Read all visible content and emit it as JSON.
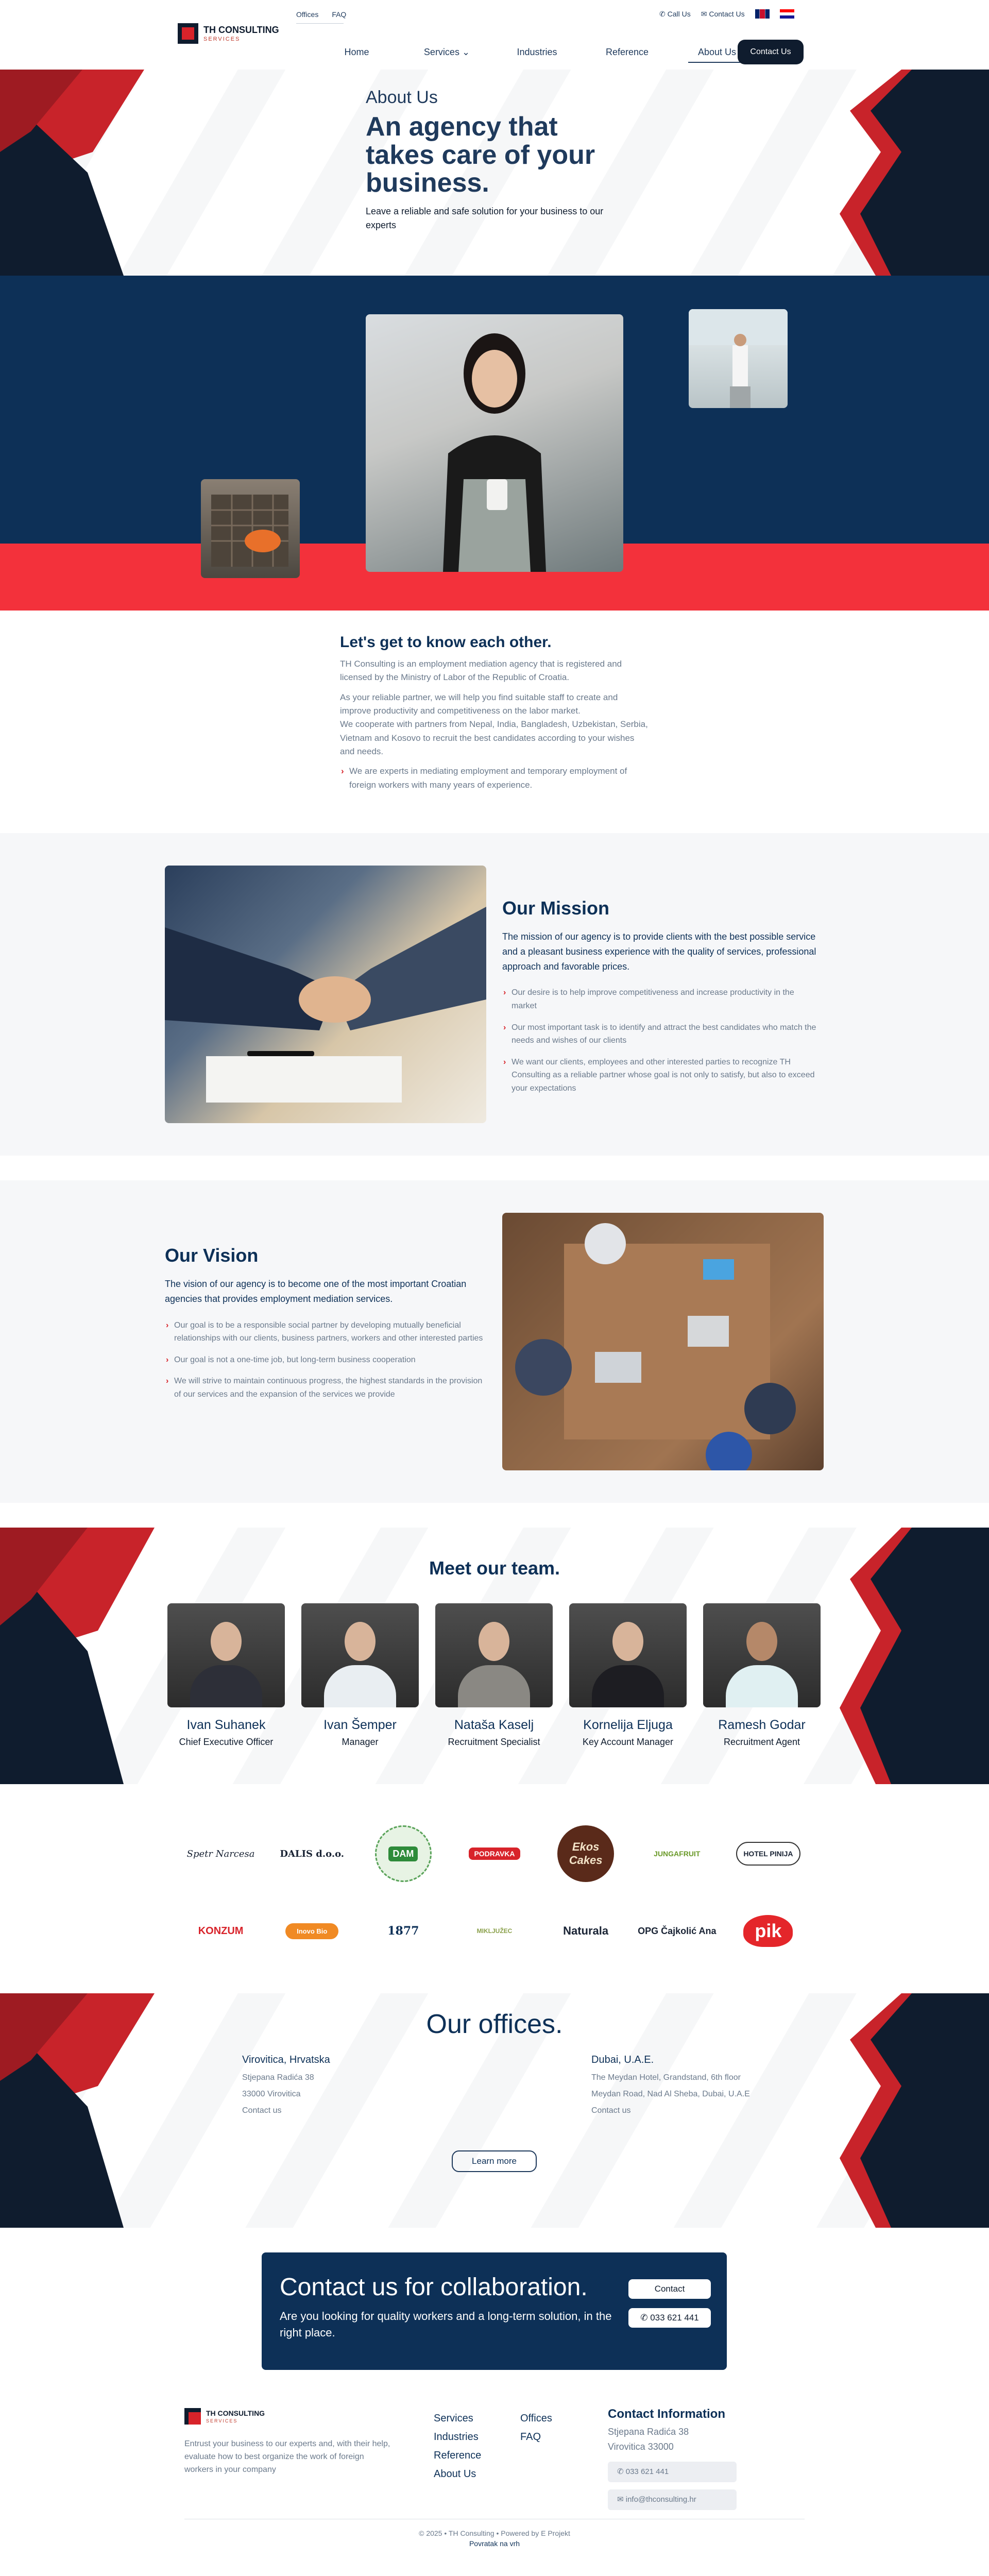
{
  "header": {
    "logo_name": "TH CONSULTING",
    "logo_sub": "SERVICES",
    "top_links": [
      "Offices",
      "FAQ"
    ],
    "call_us": "Call Us",
    "contact_us": "Contact Us",
    "nav": [
      "Home",
      "Services",
      "Industries",
      "Reference",
      "About Us"
    ],
    "contact_button": "Contact Us"
  },
  "hero": {
    "small_title": "About Us",
    "title": "An agency that takes care of your business.",
    "lead": "Leave a reliable and safe solution for your business to our experts"
  },
  "know": {
    "title": "Let's get to know each other.",
    "p1": "TH Consulting is an employment mediation agency that is registered and licensed by the Ministry of Labor of the Republic of Croatia.",
    "p2": "As your reliable partner, we will help you find suitable staff to create and improve productivity and competitiveness on the labor market.",
    "p3": "We cooperate with partners from Nepal, India, Bangladesh, Uzbekistan, Serbia, Vietnam and Kosovo to recruit the best candidates according to your wishes and needs.",
    "bullet": "We are experts in mediating employment and temporary employment of foreign workers with many years of experience."
  },
  "mission": {
    "title": "Our Mission",
    "lead": "The mission of our agency is to provide clients with the best possible service and a pleasant business experience with the quality of services, professional approach and favorable prices.",
    "bullets": [
      "Our desire is to help improve competitiveness and increase productivity in the market",
      "Our most important task is to identify and attract the best candidates who match the needs and wishes of our clients",
      "We want our clients, employees and other interested parties to recognize TH Consulting as a reliable partner whose goal is not only to satisfy, but also to exceed your expectations"
    ]
  },
  "vision": {
    "title": "Our Vision",
    "lead": "The vision of our agency is to become one of the most important Croatian agencies that provides employment mediation services.",
    "bullets": [
      "Our goal is to be a responsible social partner by developing mutually beneficial relationships with our clients, business partners, workers and other interested parties",
      "Our goal is not a one-time job, but long-term business cooperation",
      "We will strive to maintain continuous progress, the highest standards in the provision of our services and the expansion of the services we provide"
    ]
  },
  "team": {
    "title": "Meet our team.",
    "members": [
      {
        "name": "Ivan Suhanek",
        "role": "Chief Executive Officer"
      },
      {
        "name": "Ivan Šemper",
        "role": "Manager"
      },
      {
        "name": "Nataša Kaselj",
        "role": "Recruitment Specialist"
      },
      {
        "name": "Kornelija Eljuga",
        "role": "Key Account Manager"
      },
      {
        "name": "Ramesh Godar",
        "role": "Recruitment Agent"
      }
    ]
  },
  "logos": {
    "row1": [
      "Spetr Narcesa",
      "DALIS d.o.o.",
      "DAM",
      "PODRAVKA",
      "Ekos Cakes",
      "JUNGAFRUIT",
      "HOTEL PINIJA"
    ],
    "row2": [
      "KONZUM",
      "Inovo Bio",
      "1877",
      "MIKLJUŽEC",
      "Naturala",
      "OPG Čajkolić Ana",
      "pik"
    ]
  },
  "offices": {
    "title": "Our offices.",
    "left": {
      "city": "Virovitica, Hrvatska",
      "line1": "Stjepana Radića 38",
      "line2": "33000 Virovitica",
      "link": "Contact us"
    },
    "right": {
      "city": "Dubai, U.A.E.",
      "line1": "The Meydan Hotel, Grandstand, 6th floor",
      "line2": "Meydan Road, Nad Al Sheba, Dubai, U.A.E",
      "link": "Contact us"
    },
    "learn_more": "Learn more"
  },
  "cta": {
    "title": "Contact us for collaboration.",
    "text": "Are you looking for quality workers and a long-term solution, in the right place.",
    "contact_btn": "Contact",
    "phone_btn": "033 621 441"
  },
  "footer": {
    "desc": "Entrust your business to our experts and, with their help, evaluate how to best organize the work of foreign workers in your company",
    "col1": [
      "Services",
      "Industries",
      "Reference",
      "About Us"
    ],
    "col2": [
      "Offices",
      "FAQ"
    ],
    "contact_title": "Contact Information",
    "addr1": "Stjepana Radića 38",
    "addr2": "Virovitica 33000",
    "phone": "033 621 441",
    "email": "info@thconsulting.hr",
    "copyright": "© 2025 • TH Consulting • Powered by E Projekt",
    "back": "Povratak na vrh"
  },
  "colors": {
    "navy": "#0d3057",
    "red": "#f3313b",
    "dark": "#0f1c2e"
  }
}
